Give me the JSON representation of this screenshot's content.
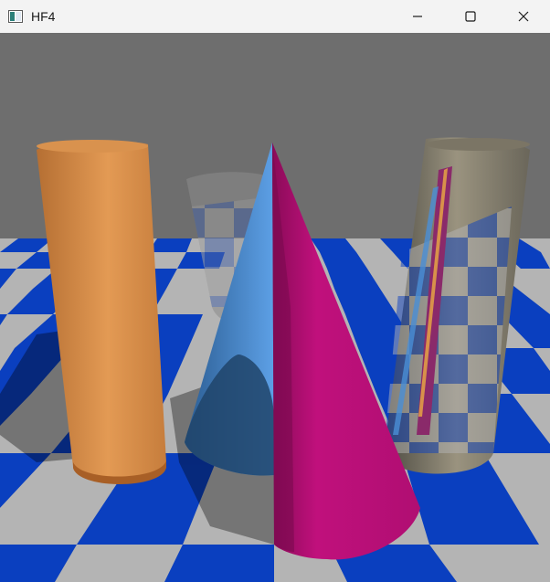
{
  "window": {
    "title": "HF4",
    "icon": "app-window-icon",
    "controls": [
      "minimize-icon",
      "maximize-icon",
      "close-icon"
    ]
  },
  "scene": {
    "description_colors": {
      "sky": "#6e6e6e",
      "floor_light": "#b4b4b4",
      "floor_blue": "#0a3fbf",
      "orange_cylinder": "#d8914a",
      "light_blue_cone": "#4a8fd6",
      "magenta_cone": "#c0107c",
      "mirror_cylinder": "#8a8476"
    }
  }
}
